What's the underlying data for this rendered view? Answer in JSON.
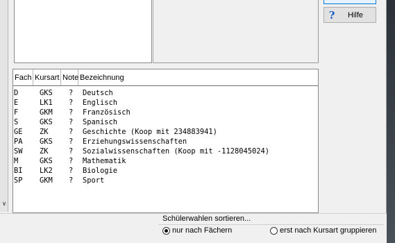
{
  "help_button": {
    "label": "Hilfe",
    "icon": "help-question-icon"
  },
  "grid": {
    "headers": {
      "fach": "Fach",
      "kursart": "Kursart",
      "note": "Note",
      "bezeichnung": "Bezeichnung"
    },
    "rows": [
      {
        "fach": "D",
        "kursart": "GKS",
        "note": "?",
        "bezeichnung": "Deutsch"
      },
      {
        "fach": "E",
        "kursart": "LK1",
        "note": "?",
        "bezeichnung": "Englisch"
      },
      {
        "fach": "F",
        "kursart": "GKM",
        "note": "?",
        "bezeichnung": "Französisch"
      },
      {
        "fach": "S",
        "kursart": "GKS",
        "note": "?",
        "bezeichnung": "Spanisch"
      },
      {
        "fach": "GE",
        "kursart": "ZK",
        "note": "?",
        "bezeichnung": "Geschichte (Koop mit 234883941)"
      },
      {
        "fach": "PA",
        "kursart": "GKS",
        "note": "?",
        "bezeichnung": "Erziehungswissenschaften"
      },
      {
        "fach": "SW",
        "kursart": "ZK",
        "note": "?",
        "bezeichnung": "Sozialwissenschaften (Koop mit -1128045024)"
      },
      {
        "fach": "M",
        "kursart": "GKS",
        "note": "?",
        "bezeichnung": "Mathematik"
      },
      {
        "fach": "BI",
        "kursart": "LK2",
        "note": "?",
        "bezeichnung": "Biologie"
      },
      {
        "fach": "SP",
        "kursart": "GKM",
        "note": "?",
        "bezeichnung": "Sport"
      }
    ]
  },
  "sort": {
    "title": "Schülerwahlen sortieren...",
    "option_faecher": "nur nach Fächern",
    "option_kursart": "erst nach Kursart gruppieren",
    "selected": "faecher"
  },
  "colors": {
    "help_icon": "#1c5ec7",
    "focus_border": "#0078d7"
  }
}
